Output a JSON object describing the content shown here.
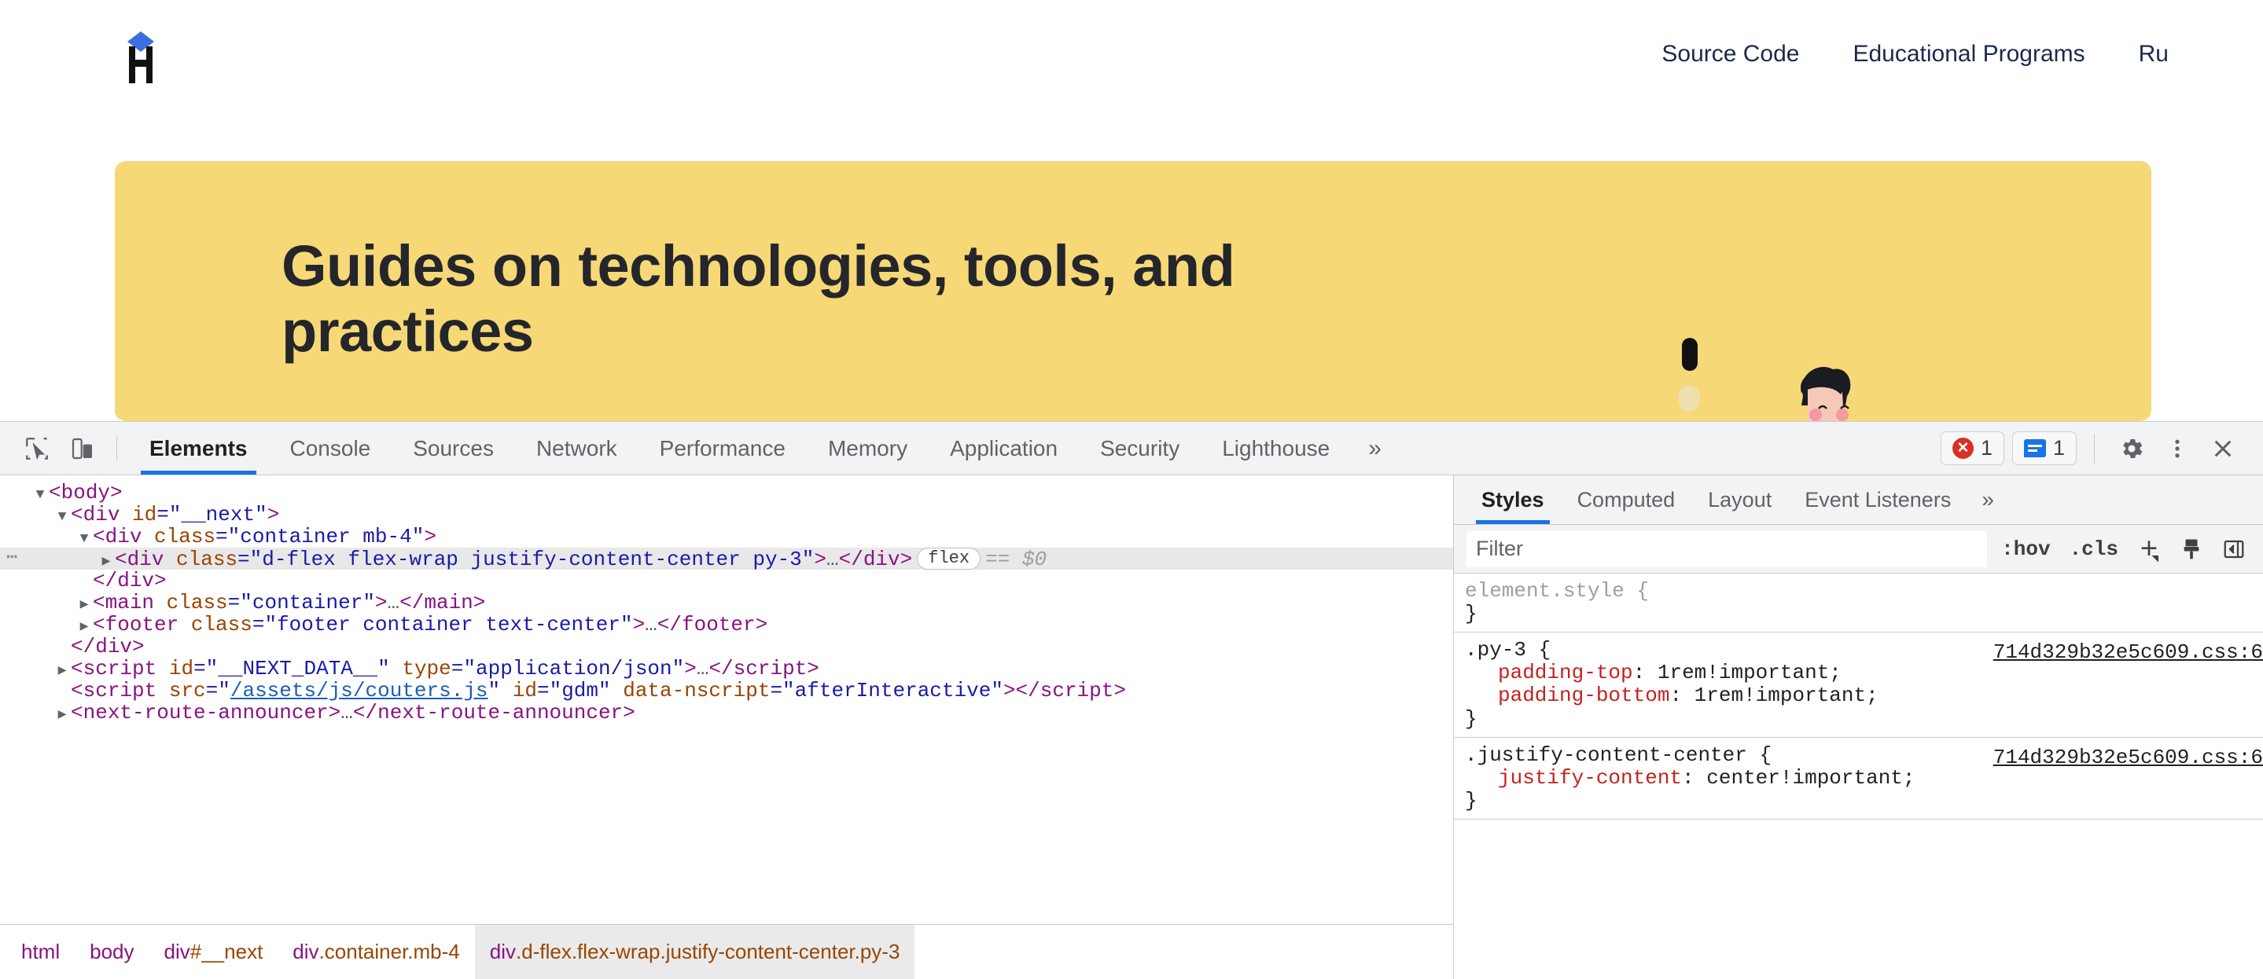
{
  "site": {
    "logo_icon": "hyperskill-h-logo",
    "nav": [
      {
        "label": "Source Code"
      },
      {
        "label": "Educational Programs"
      },
      {
        "label": "Ru"
      }
    ],
    "hero": {
      "title": "Guides on technologies, tools, and practices",
      "background_color": "#F6D877",
      "illustration": "desk-scene-illustration"
    }
  },
  "devtools": {
    "toolbar": {
      "inspect_icon": "inspect-element-icon",
      "device_icon": "device-toolbar-icon",
      "tabs": [
        {
          "label": "Elements",
          "active": true
        },
        {
          "label": "Console",
          "active": false
        },
        {
          "label": "Sources",
          "active": false
        },
        {
          "label": "Network",
          "active": false
        },
        {
          "label": "Performance",
          "active": false
        },
        {
          "label": "Memory",
          "active": false
        },
        {
          "label": "Application",
          "active": false
        },
        {
          "label": "Security",
          "active": false
        },
        {
          "label": "Lighthouse",
          "active": false
        }
      ],
      "more_tabs_icon": "chevron-double-right-icon",
      "error_count": "1",
      "message_count": "1",
      "settings_icon": "gear-icon",
      "menu_icon": "kebab-menu-icon",
      "close_icon": "close-icon",
      "accent_color": "#1a73e8",
      "error_color": "#d93025"
    },
    "dom_tree": {
      "rows": [
        {
          "indent": 1,
          "twisty": "open",
          "html": "body-open"
        },
        {
          "indent": 2,
          "twisty": "open",
          "html": "div-next-open"
        },
        {
          "indent": 3,
          "twisty": "open",
          "html": "div-container-mb4-open"
        },
        {
          "indent": 4,
          "twisty": "closed",
          "html": "div-dflex-selected",
          "selected": true
        },
        {
          "indent": 3,
          "twisty": "none",
          "html": "div-close-1"
        },
        {
          "indent": 3,
          "twisty": "closed",
          "html": "main-container"
        },
        {
          "indent": 3,
          "twisty": "closed",
          "html": "footer"
        },
        {
          "indent": 2,
          "twisty": "none",
          "html": "div-close-2"
        },
        {
          "indent": 2,
          "twisty": "closed",
          "html": "script-next-data"
        },
        {
          "indent": 2,
          "twisty": "none",
          "html": "script-gdm"
        },
        {
          "indent": 2,
          "twisty": "closed",
          "html": "next-route-announcer"
        }
      ],
      "tokens": {
        "body_tag": "body",
        "div_tag": "div",
        "main_tag": "main",
        "footer_tag": "footer",
        "script_tag": "script",
        "announcer_tag": "next-route-announcer",
        "attr_id": "id",
        "attr_class": "class",
        "attr_type": "type",
        "attr_src": "src",
        "attr_nscript": "data-nscript",
        "val_next": "__next",
        "val_container_mb4": "container mb-4",
        "val_dflex": "d-flex flex-wrap justify-content-center py-3",
        "val_container": "container",
        "val_footer": "footer container text-center",
        "val_next_data": "__NEXT_DATA__",
        "val_app_json": "application/json",
        "val_src": "/assets/js/couters.js",
        "val_gdm": "gdm",
        "val_after_interactive": "afterInteractive",
        "badge_flex": "flex",
        "selected_marker": "== $0",
        "ellipsis": "…",
        "dots": "⋯"
      }
    },
    "breadcrumb": [
      {
        "tag": "html",
        "suffix": "",
        "active": false
      },
      {
        "tag": "body",
        "suffix": "",
        "active": false
      },
      {
        "tag": "div",
        "suffix": "#__next",
        "active": false
      },
      {
        "tag": "div",
        "suffix": ".container.mb-4",
        "active": false
      },
      {
        "tag": "div",
        "suffix": ".d-flex.flex-wrap.justify-content-center.py-3",
        "active": true
      }
    ],
    "styles_pane": {
      "tabs": [
        {
          "label": "Styles",
          "active": true
        },
        {
          "label": "Computed",
          "active": false
        },
        {
          "label": "Layout",
          "active": false
        },
        {
          "label": "Event Listeners",
          "active": false
        }
      ],
      "more_icon": "chevron-double-right-icon",
      "filter_placeholder": "Filter",
      "hov_label": ":hov",
      "cls_label": ".cls",
      "new_rule_icon": "plus-new-style-rule-icon",
      "color_picker_icon": "paint-brush-icon",
      "sidebar_toggle_icon": "toggle-sidebar-icon",
      "rules": [
        {
          "selector": "element.style",
          "selector_muted": true,
          "source": "",
          "declarations": []
        },
        {
          "selector": ".py-3",
          "selector_muted": false,
          "source": "714d329b32e5c609.css:6",
          "declarations": [
            {
              "prop": "padding-top",
              "value": "1rem!important;"
            },
            {
              "prop": "padding-bottom",
              "value": "1rem!important;"
            }
          ]
        },
        {
          "selector": ".justify-content-center",
          "selector_muted": false,
          "source": "714d329b32e5c609.css:6",
          "declarations": [
            {
              "prop": "justify-content",
              "value": "center!important;"
            }
          ]
        }
      ],
      "open_brace": "{",
      "close_brace": "}"
    }
  }
}
